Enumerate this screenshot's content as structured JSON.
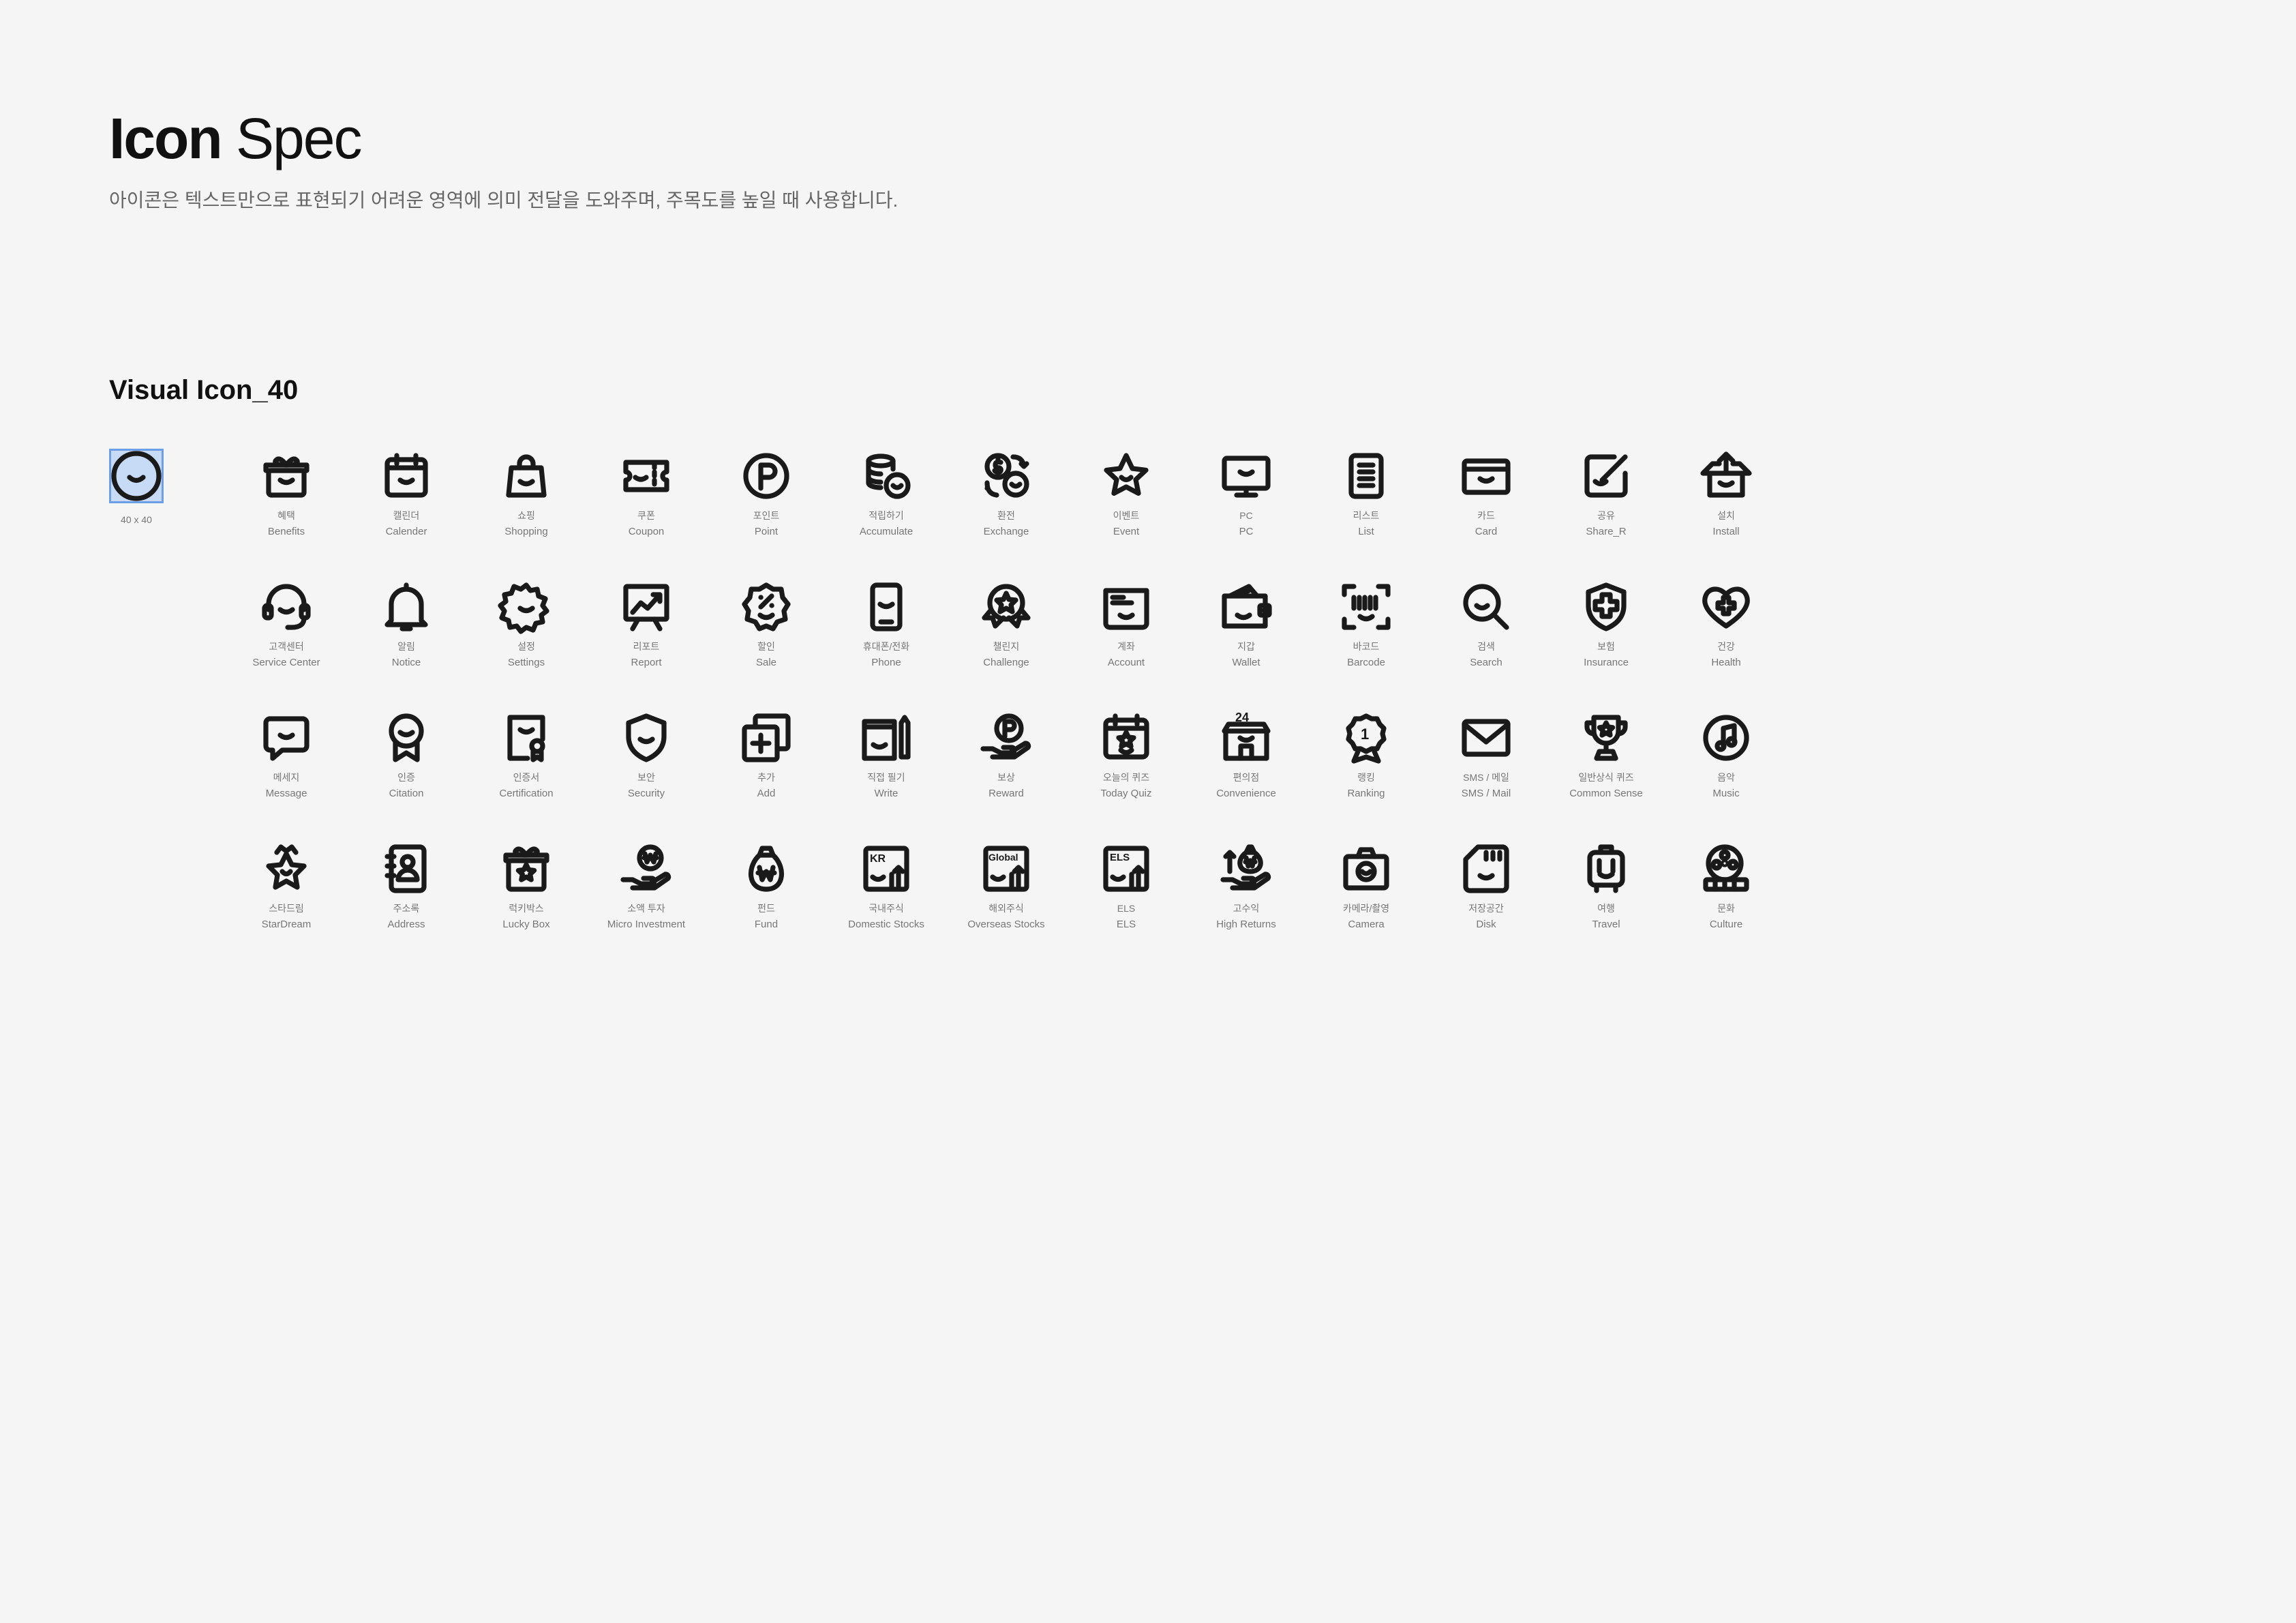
{
  "header": {
    "title_bold": "Icon",
    "title_light": "Spec",
    "description": "아이콘은 텍스트만으로 표현되기 어려운 영역에 의미 전달을 도와주며, 주목도를 높일 때 사용합니다."
  },
  "section": {
    "title": "Visual Icon_40",
    "sample_size": "40 x 40",
    "sample_icon": "smile-circle-icon",
    "selection_color": "#c7dbf7"
  },
  "icons": [
    {
      "ko": "혜택",
      "en": "Benefits",
      "icon": "gift-icon"
    },
    {
      "ko": "캘린더",
      "en": "Calender",
      "icon": "calendar-icon"
    },
    {
      "ko": "쇼핑",
      "en": "Shopping",
      "icon": "shopping-bag-icon"
    },
    {
      "ko": "쿠폰",
      "en": "Coupon",
      "icon": "coupon-icon"
    },
    {
      "ko": "포인트",
      "en": "Point",
      "icon": "point-coin-icon"
    },
    {
      "ko": "적립하기",
      "en": "Accumulate",
      "icon": "coin-stack-icon"
    },
    {
      "ko": "환전",
      "en": "Exchange",
      "icon": "exchange-icon"
    },
    {
      "ko": "이벤트",
      "en": "Event",
      "icon": "star-icon"
    },
    {
      "ko": "PC",
      "en": "PC",
      "icon": "monitor-icon"
    },
    {
      "ko": "리스트",
      "en": "List",
      "icon": "list-icon"
    },
    {
      "ko": "카드",
      "en": "Card",
      "icon": "card-icon"
    },
    {
      "ko": "공유",
      "en": "Share_R",
      "icon": "share-icon"
    },
    {
      "ko": "설치",
      "en": "Install",
      "icon": "install-box-icon"
    },
    {
      "ko": "고객센터",
      "en": "Service Center",
      "icon": "headset-icon"
    },
    {
      "ko": "알림",
      "en": "Notice",
      "icon": "bell-icon"
    },
    {
      "ko": "설정",
      "en": "Settings",
      "icon": "gear-icon"
    },
    {
      "ko": "리포트",
      "en": "Report",
      "icon": "report-chart-icon"
    },
    {
      "ko": "할인",
      "en": "Sale",
      "icon": "sale-badge-icon"
    },
    {
      "ko": "휴대폰/전화",
      "en": "Phone",
      "icon": "phone-icon"
    },
    {
      "ko": "챌린지",
      "en": "Challenge",
      "icon": "challenge-medal-icon"
    },
    {
      "ko": "계좌",
      "en": "Account",
      "icon": "account-icon"
    },
    {
      "ko": "지갑",
      "en": "Wallet",
      "icon": "wallet-icon"
    },
    {
      "ko": "바코드",
      "en": "Barcode",
      "icon": "barcode-icon"
    },
    {
      "ko": "검색",
      "en": "Search",
      "icon": "search-icon"
    },
    {
      "ko": "보험",
      "en": "Insurance",
      "icon": "insurance-shield-icon"
    },
    {
      "ko": "건강",
      "en": "Health",
      "icon": "health-heart-icon"
    },
    {
      "ko": "메세지",
      "en": "Message",
      "icon": "message-icon"
    },
    {
      "ko": "인증",
      "en": "Citation",
      "icon": "citation-ribbon-icon"
    },
    {
      "ko": "인증서",
      "en": "Certification",
      "icon": "certificate-icon"
    },
    {
      "ko": "보안",
      "en": "Security",
      "icon": "shield-icon"
    },
    {
      "ko": "추가",
      "en": "Add",
      "icon": "add-icon"
    },
    {
      "ko": "직접 필기",
      "en": "Write",
      "icon": "write-icon"
    },
    {
      "ko": "보상",
      "en": "Reward",
      "icon": "reward-icon"
    },
    {
      "ko": "오늘의 퀴즈",
      "en": "Today Quiz",
      "icon": "quiz-calendar-icon"
    },
    {
      "ko": "편의점",
      "en": "Convenience",
      "icon": "store-24-icon"
    },
    {
      "ko": "랭킹",
      "en": "Ranking",
      "icon": "ranking-badge-icon"
    },
    {
      "ko": "SMS / 메일",
      "en": "SMS / Mail",
      "icon": "mail-icon"
    },
    {
      "ko": "일반상식 퀴즈",
      "en": "Common Sense",
      "icon": "trophy-icon"
    },
    {
      "ko": "음악",
      "en": "Music",
      "icon": "music-icon"
    },
    {
      "ko": "스타드림",
      "en": "StarDream",
      "icon": "star-crown-icon"
    },
    {
      "ko": "주소록",
      "en": "Address",
      "icon": "address-book-icon"
    },
    {
      "ko": "럭키박스",
      "en": "Lucky Box",
      "icon": "lucky-box-icon"
    },
    {
      "ko": "소액 투자",
      "en": "Micro Investment",
      "icon": "micro-investment-icon"
    },
    {
      "ko": "펀드",
      "en": "Fund",
      "icon": "money-bag-icon"
    },
    {
      "ko": "국내주식",
      "en": "Domestic Stocks",
      "icon": "kr-stocks-icon",
      "badge": "KR"
    },
    {
      "ko": "해외주식",
      "en": "Overseas Stocks",
      "icon": "global-stocks-icon",
      "badge": "Global"
    },
    {
      "ko": "ELS",
      "en": "ELS",
      "icon": "els-icon",
      "badge": "ELS"
    },
    {
      "ko": "고수익",
      "en": "High Returns",
      "icon": "high-returns-icon"
    },
    {
      "ko": "카메라/촬영",
      "en": "Camera",
      "icon": "camera-icon"
    },
    {
      "ko": "저장공간",
      "en": "Disk",
      "icon": "disk-icon"
    },
    {
      "ko": "여행",
      "en": "Travel",
      "icon": "luggage-icon"
    },
    {
      "ko": "문화",
      "en": "Culture",
      "icon": "film-reel-icon"
    }
  ]
}
